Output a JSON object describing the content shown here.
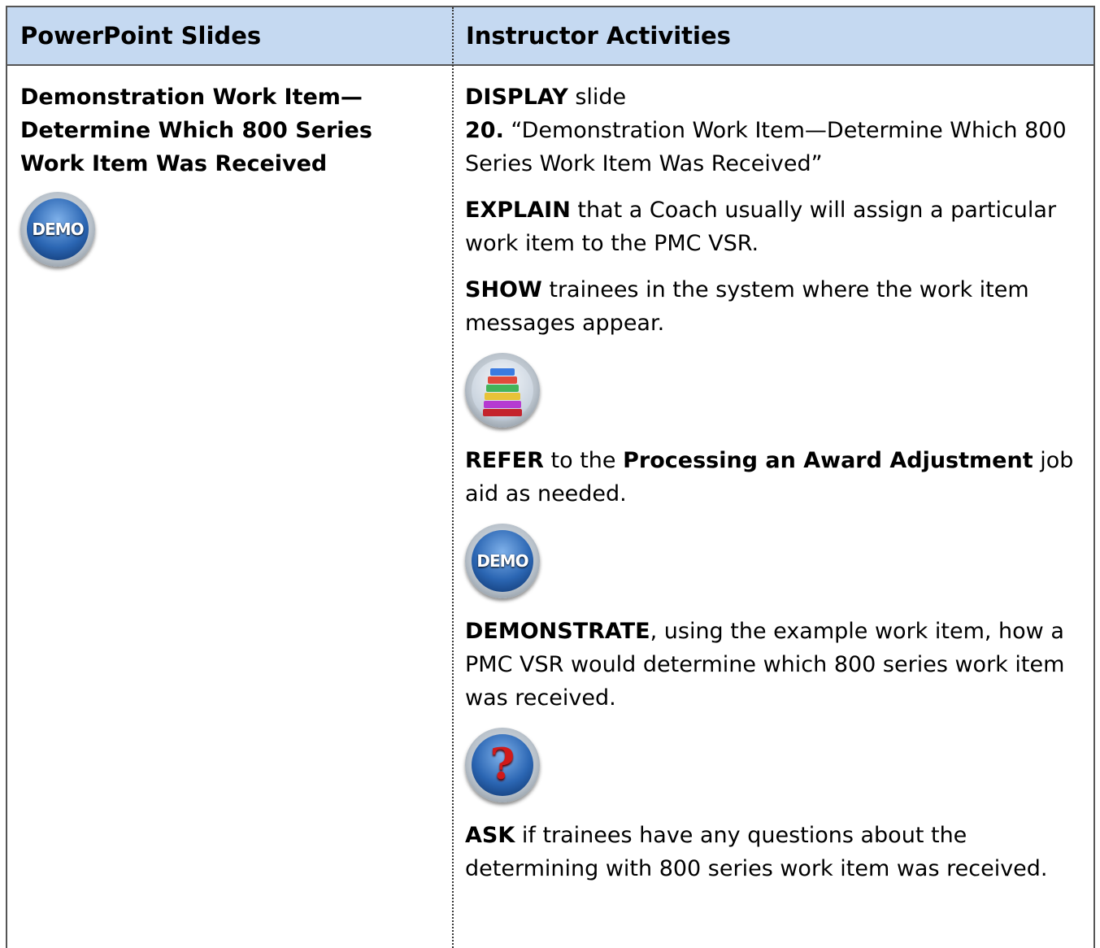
{
  "table": {
    "header_left": "PowerPoint Slides",
    "header_right": "Instructor Activities"
  },
  "left": {
    "title_line1": "Demonstration Work Item—",
    "title_line2": "Determine Which 800 Series",
    "title_line3": "Work Item Was Received",
    "icon": "demo-icon",
    "icon_text": "DEMO"
  },
  "right": {
    "display_verb": "DISPLAY",
    "display_rest": " slide",
    "slide_num": "20.",
    "slide_title": " “Demonstration Work Item—Determine Which 800 Series Work Item Was Received”",
    "explain_verb": "EXPLAIN",
    "explain_rest": " that a Coach usually will assign a particular work item to the PMC VSR.",
    "show_verb": "SHOW",
    "show_rest": " trainees in the system where the work item messages appear.",
    "books_icon": "job-aid-books-icon",
    "refer_verb": "REFER",
    "refer_mid": " to the ",
    "refer_bold": "Processing an Award Adjustment",
    "refer_rest": " job aid as needed.",
    "demo_icon": "demo-icon",
    "demo_icon_text": "DEMO",
    "demonstrate_verb": "DEMONSTRATE",
    "demonstrate_rest": ", using the example work item, how a PMC VSR would determine which 800 series work item was received.",
    "question_icon": "question-icon",
    "question_icon_text": "?",
    "ask_verb": "ASK",
    "ask_rest": " if trainees have any questions about the determining with 800 series work item was received."
  },
  "colors": {
    "header_bg": "#c5d9f1",
    "icon_blue": "#2b66b3",
    "question_red": "#d11a1a"
  }
}
